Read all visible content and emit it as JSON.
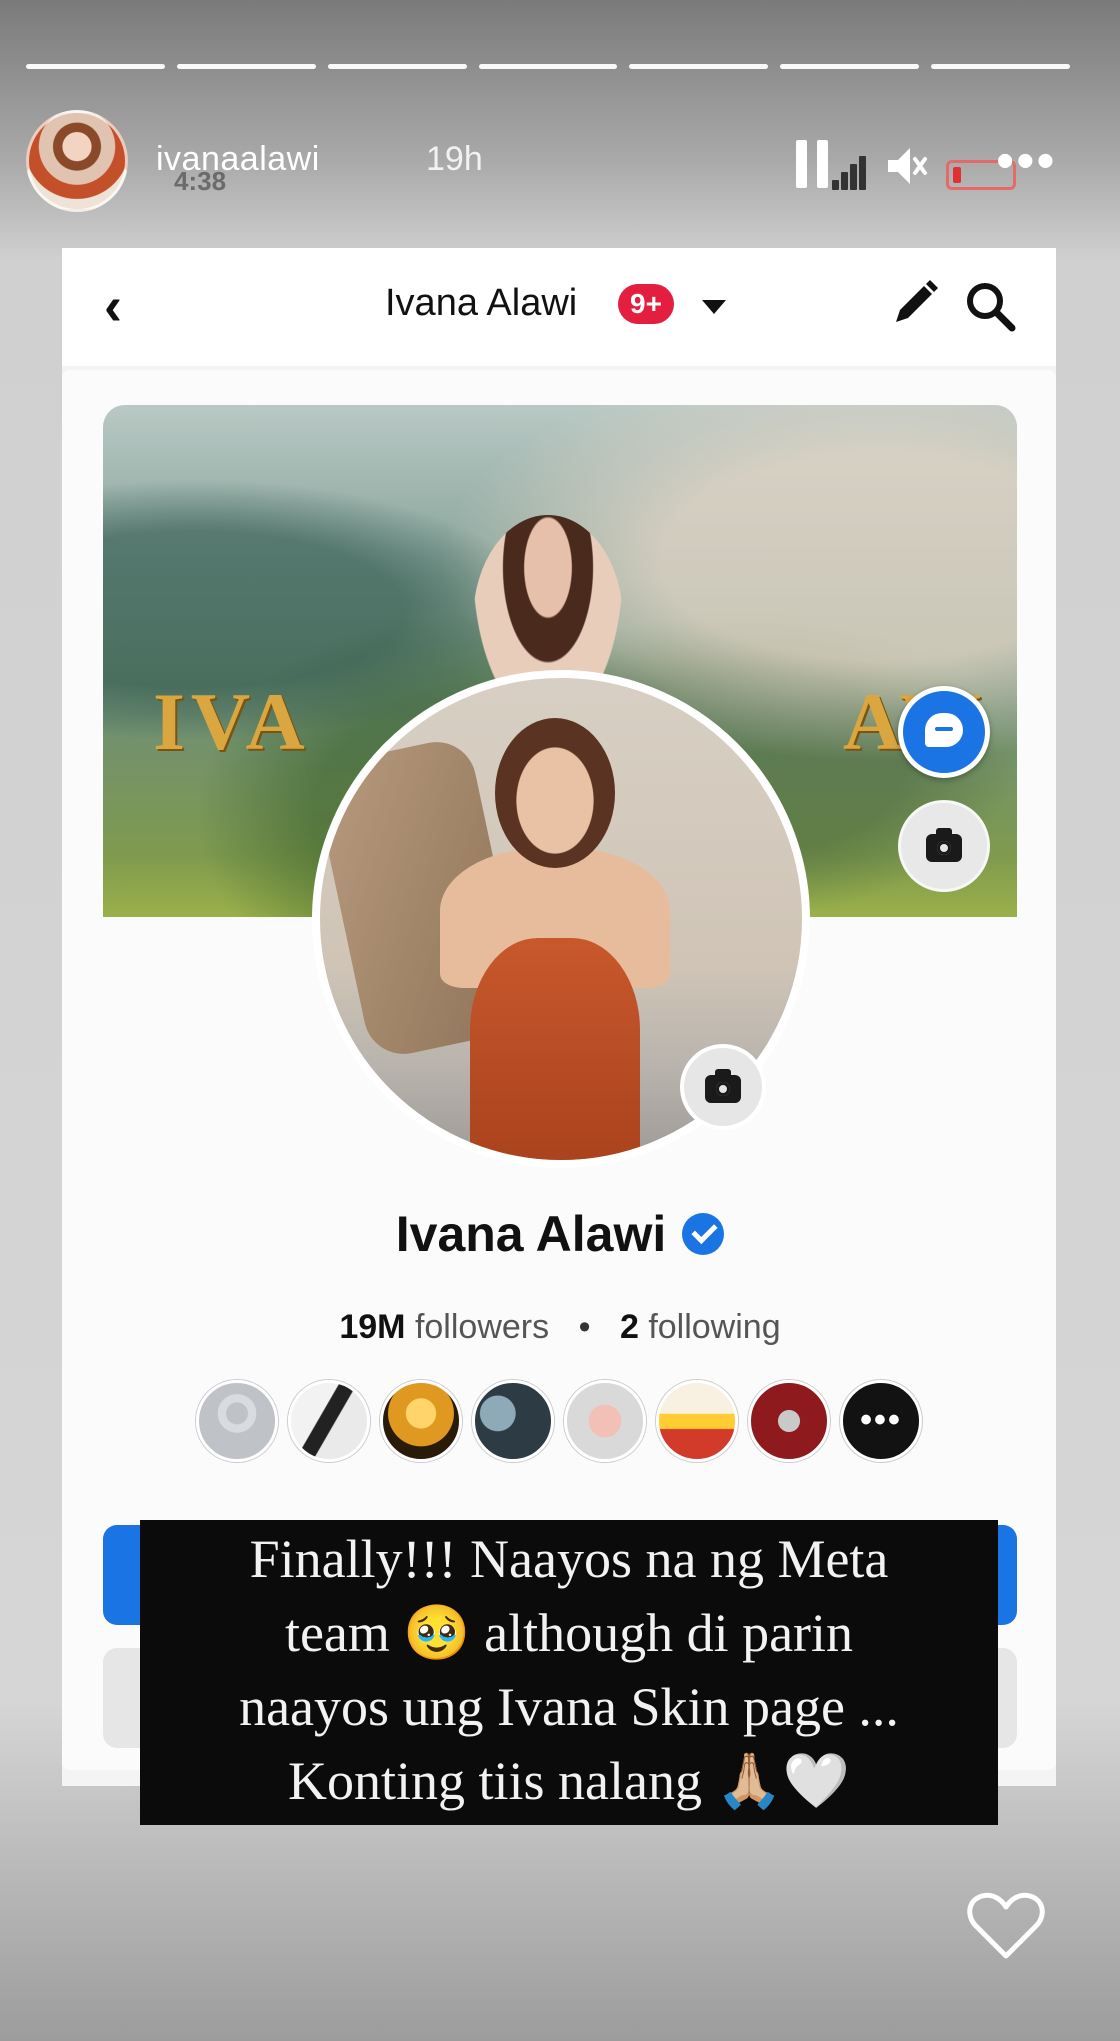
{
  "story": {
    "progress_total": 7,
    "progress_done": 7,
    "username": "ivanaalawi",
    "time_ago": "19h",
    "clock_ghost": "4:38"
  },
  "fb_header": {
    "title": "Ivana Alawi",
    "badge": "9+"
  },
  "cover": {
    "text_left": "IVA",
    "text_right": "AW"
  },
  "profile": {
    "name": "Ivana Alawi",
    "followers_count": "19M",
    "followers_label": "followers",
    "separator": "•",
    "following_count": "2",
    "following_label": "following",
    "friend_avatars": 8,
    "more_glyph": "•••"
  },
  "caption_lines": [
    "Finally!!! Naayos na ng Meta",
    "team 🥹 although di parin",
    "naayos ung Ivana Skin page ...",
    "Konting tiis nalang 🙏🏼🤍"
  ],
  "colors": {
    "facebook_blue": "#1b74e4",
    "badge_red": "#e41e3f",
    "cover_gold": "#d9a640"
  },
  "icons": [
    "pause-icon",
    "signal-icon",
    "mute-icon",
    "battery-icon",
    "more-icon",
    "back-icon",
    "caret-icon",
    "pencil-icon",
    "search-icon",
    "messenger-icon",
    "camera-icon",
    "verified-icon",
    "heart-icon"
  ]
}
